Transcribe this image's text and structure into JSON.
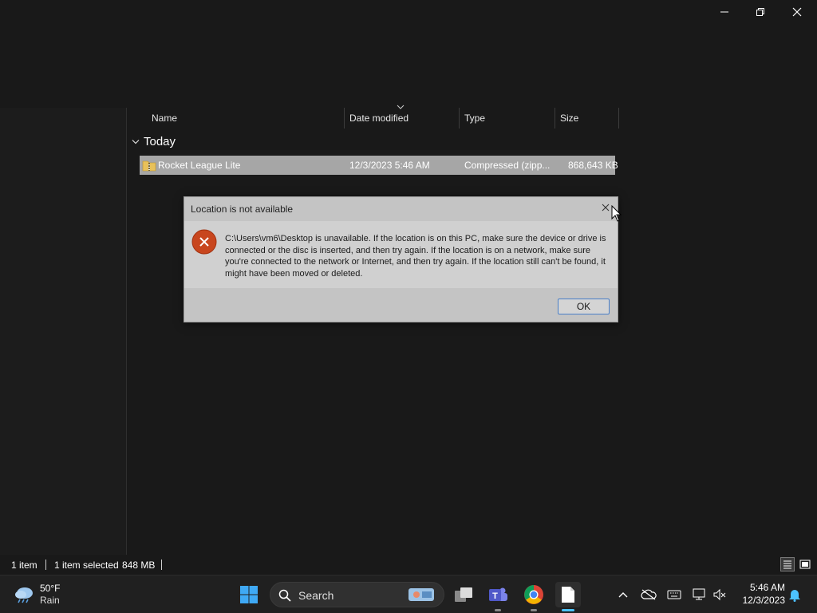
{
  "window": {
    "minimize": "–",
    "maximize": "❐",
    "close": "✕"
  },
  "columns": {
    "name": "Name",
    "date": "Date modified",
    "type": "Type",
    "size": "Size"
  },
  "group_label": "Today",
  "file": {
    "name": "Rocket League Lite",
    "date": "12/3/2023 5:46 AM",
    "type": "Compressed (zipp...",
    "size": "868,643 KB",
    "icon": "zip-folder-icon"
  },
  "status": {
    "count": "1 item",
    "selected": "1 item selected",
    "size": "848 MB"
  },
  "dialog": {
    "title": "Location is not available",
    "message": "C:\\Users\\vm6\\Desktop is unavailable. If the location is on this PC, make sure the device or drive is connected or the disc is inserted, and then try again. If the location is on a network, make sure you're connected to the network or Internet, and then try again. If the location still can't be found, it might have been moved or deleted.",
    "ok_label": "OK",
    "icon": "error-icon"
  },
  "weather": {
    "temp": "50°F",
    "condition": "Rain"
  },
  "taskbar": {
    "search_label": "Search"
  },
  "clock": {
    "time": "5:46 AM",
    "date": "12/3/2023"
  },
  "colors": {
    "error_red": "#c42b1c",
    "accent_blue": "#4a7fc7",
    "selection": "#a6a6a6"
  }
}
